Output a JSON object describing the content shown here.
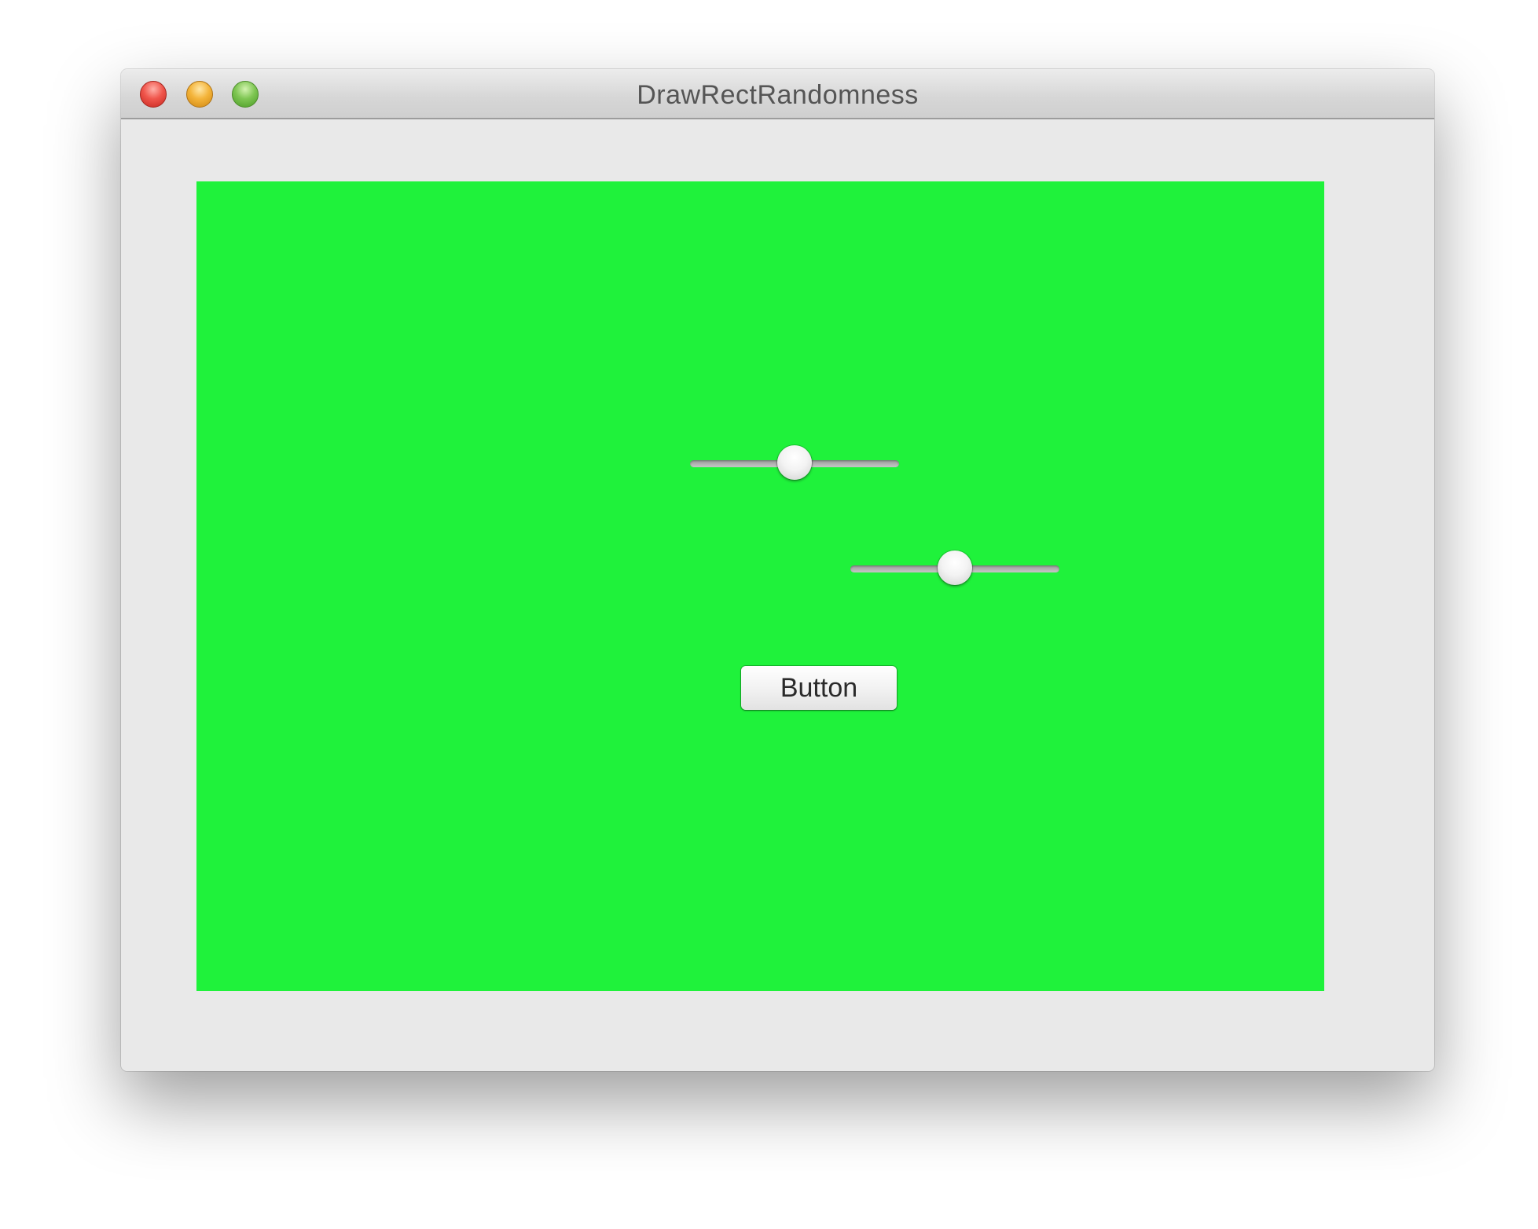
{
  "window": {
    "title": "DrawRectRandomness",
    "controls": [
      "close-icon",
      "minimize-icon",
      "zoom-icon"
    ]
  },
  "content": {
    "background_color": "#1ff23b",
    "sliders": [
      {
        "value": 0.5
      },
      {
        "value": 0.5
      }
    ],
    "button": {
      "label": "Button"
    }
  }
}
